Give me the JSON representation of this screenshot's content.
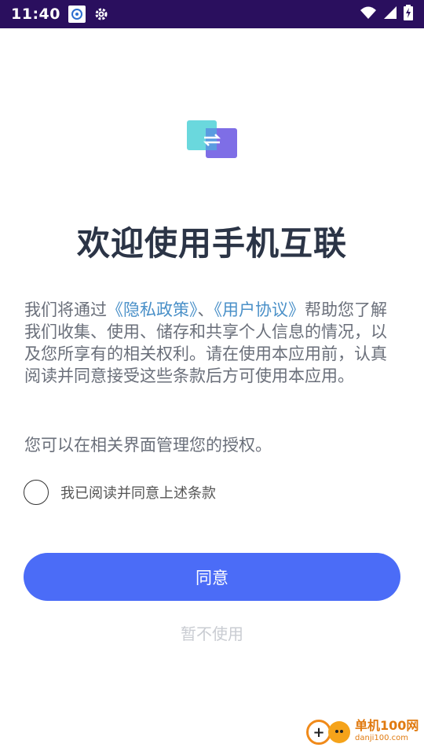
{
  "status_bar": {
    "time": "11:40",
    "icons": [
      "app-notification-icon",
      "settings-gear-icon",
      "wifi-icon",
      "signal-icon",
      "battery-charging-icon"
    ]
  },
  "logo": {
    "icon": "transfer-arrows-icon",
    "colors": {
      "back": "#6ad8dd",
      "front": "#7e6ee6"
    }
  },
  "title": "欢迎使用手机互联",
  "description": {
    "part1": "我们将通过",
    "privacy_link": "《隐私政策》",
    "sep": "、",
    "agreement_link": "《用户协议》",
    "part2": "帮助您了解我们收集、使用、储存和共享个人信息的情况，以及您所享有的相关权利。请在使用本应用前，认真阅读并同意接受这些条款后方可使用本应用。"
  },
  "description2": "您可以在相关界面管理您的授权。",
  "consent": {
    "label": "我已阅读并同意上述条款",
    "checked": false
  },
  "agree_button": "同意",
  "decline_button": "暂不使用",
  "watermark": {
    "cn": "单机100网",
    "en": "danji100.com"
  },
  "colors": {
    "accent": "#4b6cf7",
    "status_bar": "#2a0f5e",
    "link": "#4a90c8"
  }
}
